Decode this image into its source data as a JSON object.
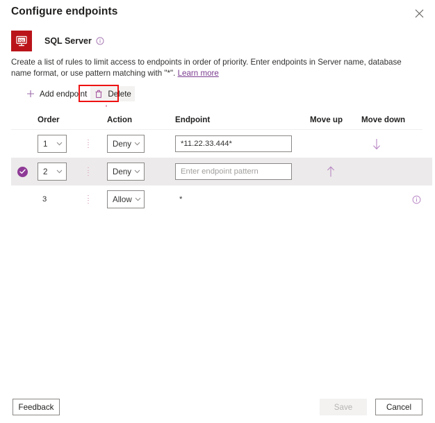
{
  "panel": {
    "title": "Configure endpoints",
    "close_icon": "close-icon"
  },
  "resource": {
    "icon_label": "SQL",
    "name": "SQL Server",
    "info_icon": "info-icon"
  },
  "description": {
    "text_before_link": "Create a list of rules to limit access to endpoints in order of priority. Enter endpoints in Server name, database name format, or use pattern matching with \"*\". ",
    "link_label": "Learn more"
  },
  "commandbar": {
    "add_label": "Add endpoint",
    "add_icon": "plus-icon",
    "delete_label": "Delete",
    "delete_icon": "trash-icon",
    "highlight_color": "#ee1111"
  },
  "grid": {
    "columns": [
      {
        "key": "order",
        "label": "Order"
      },
      {
        "key": "action",
        "label": "Action"
      },
      {
        "key": "endpoint",
        "label": "Endpoint"
      },
      {
        "key": "moveup",
        "label": "Move up"
      },
      {
        "key": "movedown",
        "label": "Move down"
      }
    ],
    "rows": [
      {
        "selected": false,
        "order": "1",
        "order_is_dropdown": true,
        "action": "Deny",
        "endpoint_value": "*11.22.33.444*",
        "endpoint_is_input": true,
        "endpoint_placeholder": "",
        "move_up": false,
        "move_down": true,
        "row_info": false
      },
      {
        "selected": true,
        "order": "2",
        "order_is_dropdown": true,
        "action": "Deny",
        "endpoint_value": "",
        "endpoint_is_input": true,
        "endpoint_placeholder": "Enter endpoint pattern",
        "move_up": true,
        "move_down": false,
        "row_info": false
      },
      {
        "selected": false,
        "order": "3",
        "order_is_dropdown": false,
        "action": "Allow",
        "endpoint_value": "*",
        "endpoint_is_input": false,
        "endpoint_placeholder": "",
        "move_up": false,
        "move_down": false,
        "row_info": true
      }
    ],
    "action_options": [
      "Allow",
      "Deny"
    ],
    "order_options": [
      "1",
      "2",
      "3"
    ]
  },
  "footer": {
    "feedback_label": "Feedback",
    "save_label": "Save",
    "save_disabled": true,
    "cancel_label": "Cancel"
  },
  "colors": {
    "accent": "#8e3a96",
    "sql_red": "#ba141a",
    "arrow": "#b887c4",
    "selected_row": "#eceaea"
  }
}
